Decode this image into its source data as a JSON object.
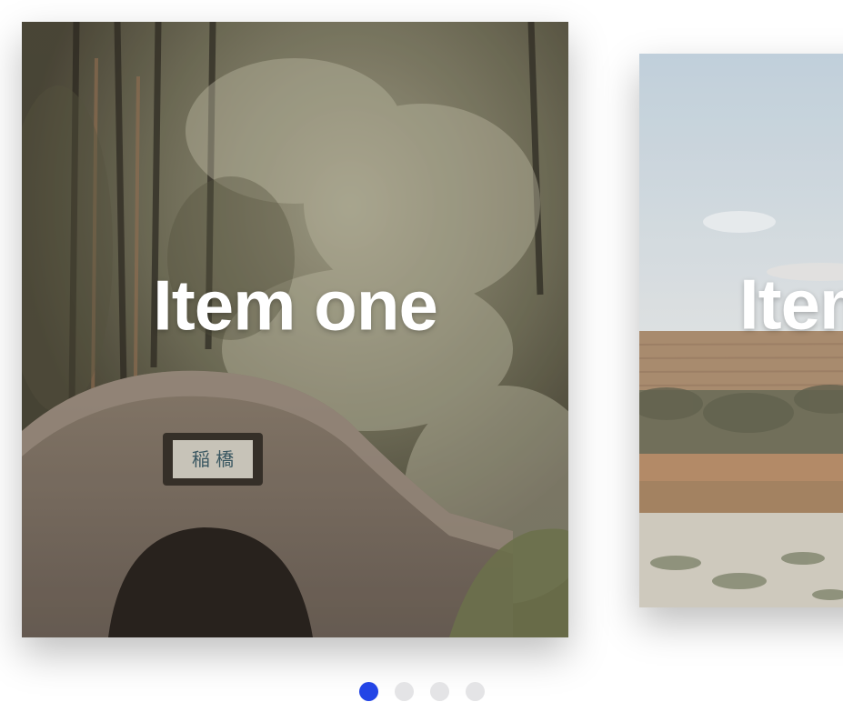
{
  "carousel": {
    "slides": [
      {
        "title": "Item one",
        "scene": "bamboo-forest-stone-bridge",
        "active": true
      },
      {
        "title": "Item two",
        "scene": "vineyard-field-landscape",
        "active": false
      }
    ],
    "pagination": {
      "count": 4,
      "active_index": 0,
      "active_color": "#2345e6",
      "inactive_color": "#e4e4e6"
    }
  }
}
